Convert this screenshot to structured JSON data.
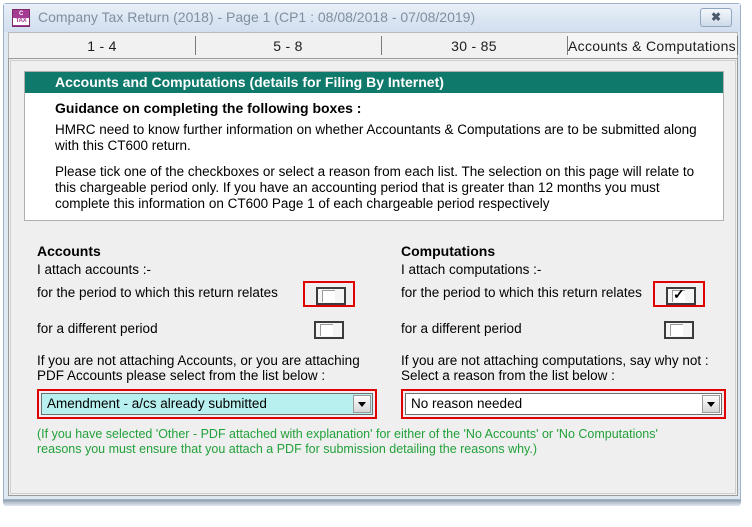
{
  "window": {
    "title": "Company Tax Return (2018) - Page 1  (CP1 : 08/08/2018 - 07/08/2019)",
    "app_icon_line1": "C",
    "app_icon_line2": "TAX",
    "close_label": "✖",
    "colors": {
      "header_teal": "#0f7a6b",
      "highlight_red": "#e00000",
      "dropdown_cyan": "#b8f0ef",
      "note_green": "#22a13a",
      "app_icon_purple": "#a53a92"
    }
  },
  "tabs": [
    {
      "label": "1 - 4",
      "active": false
    },
    {
      "label": "5 - 8",
      "active": false
    },
    {
      "label": "30 - 85",
      "active": false
    },
    {
      "label": "Accounts & Computations",
      "active": true
    }
  ],
  "guidance": {
    "header": "Accounts and Computations (details for Filing By Internet)",
    "title": "Guidance on completing the following boxes :",
    "paragraph1": "HMRC need to know further information on whether Accountants & Computations are to be submitted along with this CT600 return.",
    "paragraph2": "Please tick one of the checkboxes or select a reason from each list. The selection on this page will relate to this chargeable period only. If you have an accounting period that is greater than 12 months you must complete this information on CT600 Page 1 of each chargeable period respectively"
  },
  "accounts": {
    "heading": "Accounts",
    "subtitle": "I attach accounts :-",
    "checkbox_1_label": "for the period to which this return relates",
    "checkbox_1_checked": false,
    "checkbox_2_label": "for a different period",
    "checkbox_2_checked": false,
    "dropdown_label": "If you are not attaching Accounts, or you are attaching PDF Accounts please select from the list below :",
    "dropdown_value": "Amendment - a/cs already submitted"
  },
  "computations": {
    "heading": "Computations",
    "subtitle": "I attach computations :-",
    "checkbox_1_label": "for the period to which this return relates",
    "checkbox_1_checked": true,
    "checkbox_1_mark": "✓",
    "checkbox_2_label": "for a different period",
    "checkbox_2_checked": false,
    "dropdown_label": "If you are not attaching computations, say why not : Select a reason from the list below :",
    "dropdown_label_line1": "If you are not attaching computations, say why not :",
    "dropdown_label_line2": "Select a reason from the list below :",
    "dropdown_value": "No reason needed"
  },
  "footer_note": {
    "line1": "(If you have selected 'Other - PDF attached with explanation' for either of the 'No Accounts' or 'No Computations'",
    "line2": "reasons you must ensure that you attach a PDF for submission detailing the reasons why.)"
  }
}
